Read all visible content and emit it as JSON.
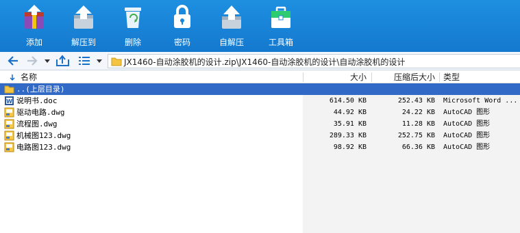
{
  "toolbar": {
    "buttons": [
      {
        "label": "添加",
        "icon": "add-archive-icon"
      },
      {
        "label": "解压到",
        "icon": "extract-to-icon"
      },
      {
        "label": "删除",
        "icon": "trash-icon"
      },
      {
        "label": "密码",
        "icon": "lock-icon"
      },
      {
        "label": "自解压",
        "icon": "self-extract-icon"
      },
      {
        "label": "工具箱",
        "icon": "toolbox-icon"
      }
    ]
  },
  "address": {
    "path": "JX1460-自动涂胶机的设计.zip\\JX1460-自动涂胶机的设计\\自动涂胶机的设计"
  },
  "columns": {
    "name": "名称",
    "size": "大小",
    "packed": "压缩后大小",
    "type": "类型"
  },
  "files": [
    {
      "name": "..(上层目录)",
      "size": "",
      "packed": "",
      "type": "",
      "icon": "folder-up-icon",
      "selected": true
    },
    {
      "name": "说明书.doc",
      "size": "614.50 KB",
      "packed": "252.43 KB",
      "type": "Microsoft Word ...",
      "icon": "word-doc-icon"
    },
    {
      "name": "驱动电路.dwg",
      "size": "44.92 KB",
      "packed": "24.22 KB",
      "type": "AutoCAD 图形",
      "icon": "dwg-file-icon"
    },
    {
      "name": "流程图.dwg",
      "size": "35.91 KB",
      "packed": "11.28 KB",
      "type": "AutoCAD 图形",
      "icon": "dwg-file-icon"
    },
    {
      "name": "机械图123.dwg",
      "size": "289.33 KB",
      "packed": "252.75 KB",
      "type": "AutoCAD 图形",
      "icon": "dwg-file-icon"
    },
    {
      "name": "电路图123.dwg",
      "size": "98.92 KB",
      "packed": "66.36 KB",
      "type": "AutoCAD 图形",
      "icon": "dwg-file-icon"
    }
  ],
  "colors": {
    "toolbar": "#1a86da",
    "selection": "#3169c6",
    "right_pane": "#f3f3f3"
  }
}
